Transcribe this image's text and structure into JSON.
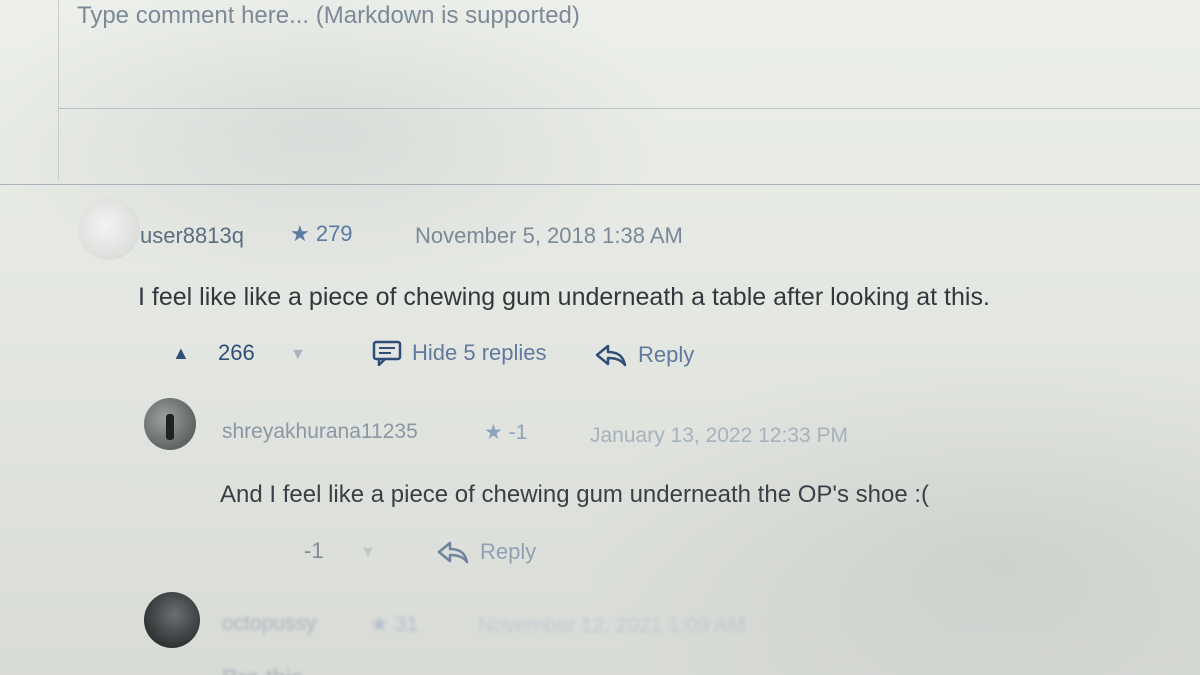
{
  "comment_input": {
    "placeholder": "Type comment here... (Markdown is supported)"
  },
  "comments": [
    {
      "username": "user8813q",
      "star": "★ 279",
      "date": "November 5, 2018 1:38 AM",
      "text": "I feel like like a piece of chewing gum underneath a table after looking at this.",
      "score": "266",
      "hide_replies_label": "Hide 5 replies",
      "reply_label": "Reply"
    },
    {
      "username": "shreyakhurana11235",
      "star": "★ -1",
      "date": "January 13, 2022 12:33 PM",
      "text": "And I feel like a piece of chewing gum underneath the OP's shoe :(",
      "score": "-1",
      "reply_label": "Reply"
    },
    {
      "username": "octopussy",
      "star": "★ 31",
      "date": "November 12, 2021 1:09 AM",
      "text": "Bro this"
    }
  ],
  "icons": {
    "upvote": "upvote-arrow-icon",
    "downvote": "downvote-arrow-icon",
    "comment": "comment-bubble-icon",
    "reply": "reply-arrow-icon",
    "star": "star-icon"
  }
}
